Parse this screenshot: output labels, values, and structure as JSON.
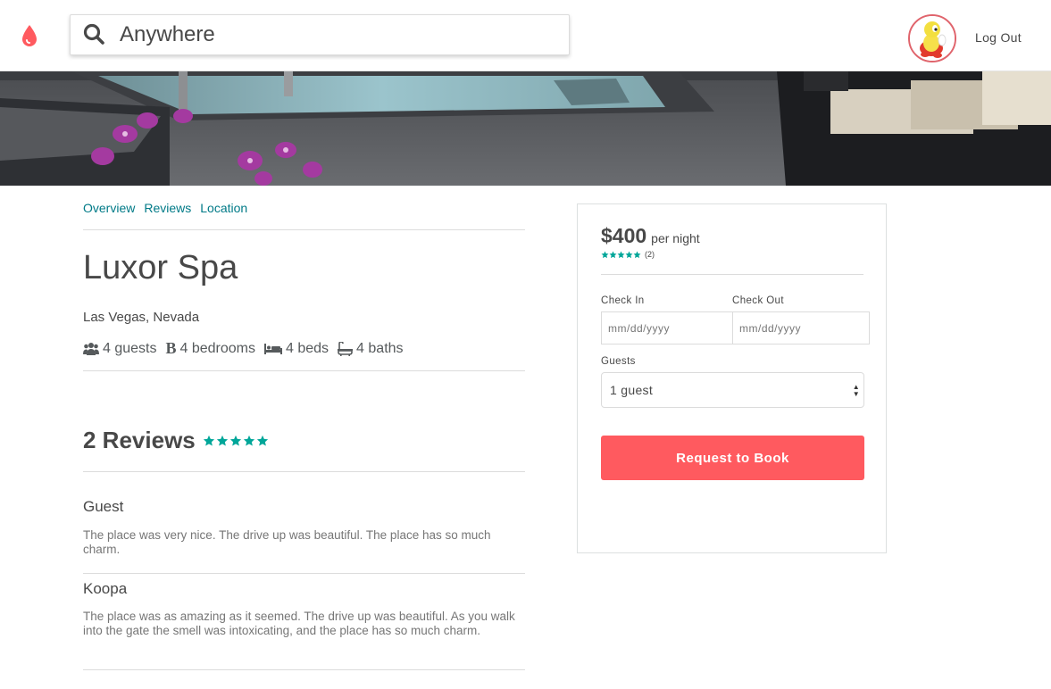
{
  "header": {
    "search_placeholder": "Anywhere",
    "logout_label": "Log Out"
  },
  "listing": {
    "subnav": [
      "Overview",
      "Reviews",
      "Location"
    ],
    "title": "Luxor Spa",
    "location": "Las Vegas, Nevada",
    "facts": {
      "guests": "4 guests",
      "bedrooms": "4 bedrooms",
      "beds": "4 beds",
      "baths": "4 baths"
    }
  },
  "reviews": {
    "heading": "2 Reviews",
    "rating": 5,
    "items": [
      {
        "name": "Guest",
        "text": "The place was very nice. The drive up was beautiful. The place has so much charm."
      },
      {
        "name": "Koopa",
        "text": "The place was as amazing as it seemed. The drive up was beautiful. As you walk into the gate the smell was intoxicating, and the place has so much charm."
      }
    ]
  },
  "booking": {
    "price": "$400",
    "per_night": "per night",
    "review_count": "(2)",
    "check_in_label": "Check In",
    "check_out_label": "Check Out",
    "date_placeholder": "mm/dd/yyyy",
    "guests_label": "Guests",
    "guests_value": "1 guest",
    "request_button": "Request to Book"
  },
  "colors": {
    "brand": "#ff5a5f",
    "link": "#007a87",
    "star": "#00a699"
  }
}
